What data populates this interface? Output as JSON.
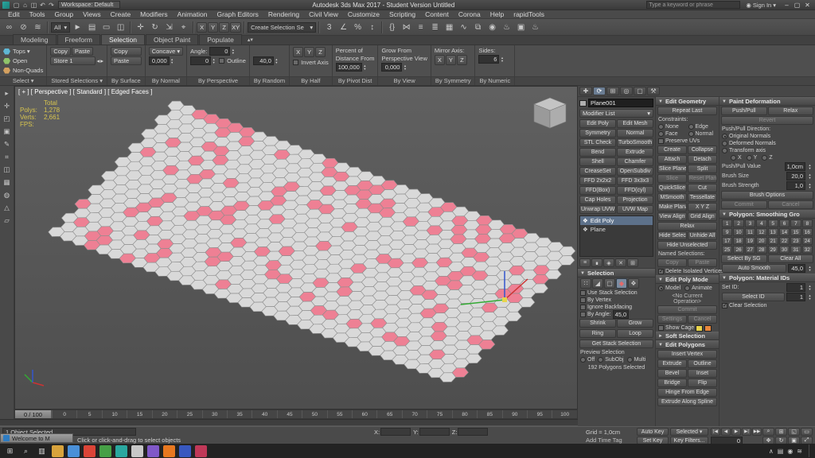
{
  "colors": {
    "accent": "#5d718a",
    "selection_pink": "#ee8094",
    "stats_yellow": "#d8c54f"
  },
  "title": {
    "workspace": "Workspace: Default",
    "text": "Autodesk 3ds Max 2017  -  Student Version   Untitled",
    "search_placeholder": "Type a keyword or phrase",
    "sign_in": "Sign In",
    "qicons": [
      {
        "g": "▢",
        "n": "new-scene-icon"
      },
      {
        "g": "⌂",
        "n": "open-file-icon"
      },
      {
        "g": "◫",
        "n": "save-file-icon"
      },
      {
        "g": "↶",
        "n": "undo-icon"
      },
      {
        "g": "↷",
        "n": "redo-icon"
      }
    ],
    "win": [
      {
        "g": "–",
        "n": "minimize-button"
      },
      {
        "g": "▢",
        "n": "maximize-button"
      },
      {
        "g": "✕",
        "n": "close-button"
      }
    ]
  },
  "menus": [
    "Edit",
    "Tools",
    "Group",
    "Views",
    "Create",
    "Modifiers",
    "Animation",
    "Graph Editors",
    "Rendering",
    "Civil View",
    "Customize",
    "Scripting",
    "Content",
    "Corona",
    "Help",
    "rapidTools"
  ],
  "toolbar": {
    "filter": "All",
    "sel_set": "Create Selection Se",
    "axis": [
      "X",
      "Y",
      "Z",
      "XY"
    ],
    "g1": [
      {
        "g": "∞",
        "n": "select-and-link-icon"
      },
      {
        "g": "⊘",
        "n": "unlink-selection-icon"
      },
      {
        "g": "≋",
        "n": "bind-to-space-warp-icon"
      }
    ],
    "g2": [
      {
        "g": "►",
        "n": "select-object-icon"
      },
      {
        "g": "▤",
        "n": "select-by-name-icon"
      },
      {
        "g": "▭",
        "n": "rectangular-selection-region-icon"
      },
      {
        "g": "◫",
        "n": "window-crossing-icon"
      }
    ],
    "g3": [
      {
        "g": "✛",
        "n": "select-and-move-icon"
      },
      {
        "g": "↻",
        "n": "select-and-rotate-icon"
      },
      {
        "g": "⇲",
        "n": "select-and-scale-icon"
      },
      {
        "g": "⌖",
        "n": "select-and-place-icon"
      }
    ],
    "g4": [
      {
        "g": "3",
        "n": "snap-toggle-icon"
      },
      {
        "g": "∠",
        "n": "angle-snap-icon"
      },
      {
        "g": "%",
        "n": "percent-snap-icon"
      },
      {
        "g": "↕",
        "n": "spinner-snap-icon"
      }
    ],
    "g5": [
      {
        "g": "{}",
        "n": "edit-named-selections-icon"
      },
      {
        "g": "⋈",
        "n": "mirror-icon"
      },
      {
        "g": "≡",
        "n": "align-icon"
      },
      {
        "g": "≣",
        "n": "layer-manager-icon"
      },
      {
        "g": "▦",
        "n": "ribbon-toggle-icon"
      },
      {
        "g": "∿",
        "n": "curve-editor-icon"
      },
      {
        "g": "⧉",
        "n": "schematic-view-icon"
      },
      {
        "g": "◉",
        "n": "material-editor-icon"
      },
      {
        "g": "♨",
        "n": "render-setup-icon"
      },
      {
        "g": "▣",
        "n": "rendered-frame-icon"
      },
      {
        "g": "♨",
        "n": "render-production-icon"
      }
    ]
  },
  "ribbon": {
    "tabs": [
      {
        "l": "Modeling"
      },
      {
        "l": "Freeform"
      },
      {
        "l": "Selection",
        "sel": true
      },
      {
        "l": "Object Paint"
      },
      {
        "l": "Populate"
      }
    ],
    "g1": {
      "items": [
        {
          "l": "Tops ▾",
          "c": "#5fb7d4"
        },
        {
          "l": "Open",
          "c": "#8fc46a"
        },
        {
          "l": "Non-Quads",
          "c": "#d4a05f"
        }
      ],
      "footer": "Select ▾"
    },
    "g2": {
      "copy": "Copy",
      "paste": "Paste",
      "store": "Store 1",
      "footer": "Stored Selections ▾"
    },
    "g3": {
      "copy": "Copy",
      "paste": "Paste",
      "footer": "By Surface"
    },
    "g4": {
      "btn": "Concave ▾",
      "spin": "0,000",
      "footer": "By Normal"
    },
    "g5": {
      "label": "Angle:",
      "spin1": "0",
      "spin2": "0",
      "check": "Outline",
      "footer": "By Perspective"
    },
    "g6": {
      "spin": "40,0",
      "footer": "By Random"
    },
    "g7": {
      "axes": [
        "X",
        "Y",
        "Z"
      ],
      "check": "Invert Axis",
      "footer": "By Half"
    },
    "g8": {
      "l1": "Percent of",
      "l2": "Distance From",
      "spin": "100,000",
      "footer": "By Pivot Dist"
    },
    "g9": {
      "l1": "Grow From",
      "l2": "Perspective View",
      "spin": "0,000",
      "footer": "By View"
    },
    "g10": {
      "label": "Mirror Axis:",
      "axes": [
        "X",
        "Y",
        "Z"
      ],
      "footer": "By Symmetry"
    },
    "g11": {
      "label": "Sides:",
      "spin": "6",
      "footer": "By Numeric"
    }
  },
  "left_tools": [
    {
      "g": "▸",
      "n": "viewport-layout-tabs-icon"
    },
    {
      "g": "✛",
      "n": "left-toolbar-icon"
    },
    {
      "g": "◰",
      "n": "left-toolbar-icon"
    },
    {
      "g": "▣",
      "n": "left-toolbar-icon"
    },
    {
      "g": "✎",
      "n": "left-toolbar-icon"
    },
    {
      "g": "⌗",
      "n": "left-toolbar-icon"
    },
    {
      "g": "◫",
      "n": "left-toolbar-icon"
    },
    {
      "g": "▦",
      "n": "left-toolbar-icon"
    },
    {
      "g": "◍",
      "n": "left-toolbar-icon"
    },
    {
      "g": "△",
      "n": "left-toolbar-icon"
    },
    {
      "g": "▱",
      "n": "left-toolbar-icon"
    }
  ],
  "viewport": {
    "label": "[ + ] [ Perspective ] [ Standard ] [ Edged Faces ]",
    "stats": {
      "rows": [
        [
          "",
          "Total"
        ],
        [
          "Polys:",
          "1,278"
        ],
        [
          "Verts:",
          "2,661"
        ],
        [
          "FPS:",
          ""
        ]
      ]
    },
    "axis_colors": {
      "x": "#cc3333",
      "y": "#33aa33",
      "z": "#3355cc"
    },
    "plane": {
      "cols": 34,
      "rows": 19,
      "ratio": 0.17,
      "seed": 13,
      "fill": "#d9d9d9",
      "sel_fill": "#ee8094",
      "stroke": "#8d8d8d",
      "matrix": [
        506.5,
        188.5,
        -158.5,
        167.5,
        198.75,
        16.75
      ]
    }
  },
  "cp": {
    "tabs": [
      {
        "g": "✚",
        "n": "create-tab-icon"
      },
      {
        "g": "⟳",
        "n": "modify-tab-icon",
        "sel": true
      },
      {
        "g": "⊞",
        "n": "hierarchy-tab-icon"
      },
      {
        "g": "◎",
        "n": "motion-tab-icon"
      },
      {
        "g": "▢",
        "n": "display-tab-icon"
      },
      {
        "g": "⚒",
        "n": "utilities-tab-icon"
      }
    ],
    "name": "Plane001",
    "modifier_list": "Modifier List",
    "modsets": [
      [
        "Edit Poly",
        "Edit Mesh"
      ],
      [
        "Symmetry",
        "Normal"
      ],
      [
        "STL Check",
        "TurboSmooth"
      ],
      [
        "Bend",
        "Extrude"
      ],
      [
        "Shell",
        "Chamfer"
      ],
      [
        "CreaseSet",
        "OpenSubdiv"
      ],
      [
        "FFD 2x2x2",
        "FFD 3x3x3"
      ],
      [
        "FFD(Box)",
        "FFD(cyl)"
      ],
      [
        "Cap Holes",
        "Projection"
      ],
      [
        "Unwrap UVW",
        "UVW Map"
      ]
    ],
    "stack": [
      {
        "l": "Edit Poly",
        "sel": true
      },
      {
        "l": "Plane"
      }
    ],
    "stack_tools": [
      {
        "g": "≡",
        "n": "pin-stack-icon"
      },
      {
        "g": "∎",
        "n": "show-end-result-icon"
      },
      {
        "g": "◈",
        "n": "make-unique-icon"
      },
      {
        "g": "✕",
        "n": "remove-modifier-icon"
      },
      {
        "g": "⊞",
        "n": "configure-modifier-sets-icon"
      }
    ],
    "sel": {
      "title": "Selection",
      "modes": [
        {
          "g": "∷",
          "n": "vertex-mode-icon"
        },
        {
          "g": "◢",
          "n": "edge-mode-icon"
        },
        {
          "g": "▢",
          "n": "border-mode-icon"
        },
        {
          "g": "◆",
          "n": "polygon-mode-icon",
          "sel": true,
          "c": "#e36a6a"
        },
        {
          "g": "❖",
          "n": "element-mode-icon"
        }
      ],
      "checks": [
        "Use Stack Selection",
        "By Vertex",
        "Ignore Backfacing"
      ],
      "by_angle": "By Angle:",
      "angle": "45,0",
      "shrink": "Shrink",
      "grow": "Grow",
      "ring": "Ring",
      "loop": "Loop",
      "get_stack": "Get Stack Selection",
      "preview": "Preview Selection",
      "preview_opts": [
        {
          "l": "Off",
          "sel": true
        },
        {
          "l": "SubObj"
        },
        {
          "l": "Multi"
        }
      ],
      "status": "192 Polygons Selected"
    },
    "eg": {
      "title": "Edit Geometry",
      "repeat": "Repeat Last",
      "constraints": "Constraints:",
      "cons": [
        {
          "l": "None",
          "sel": true
        },
        {
          "l": "Edge"
        },
        {
          "l": "Face"
        },
        {
          "l": "Normal"
        }
      ],
      "preserve": "Preserve UVs",
      "pairs": [
        [
          "Create",
          "Collapse"
        ],
        [
          "Attach",
          "Detach"
        ],
        [
          "Slice Plane",
          "Split"
        ],
        [
          "Slice",
          "Reset Plane"
        ],
        [
          "QuickSlice",
          "Cut"
        ],
        [
          "MSmooth",
          "Tessellate"
        ],
        [
          "Make Planar",
          "X Y Z"
        ],
        [
          "View Align",
          "Grid Align"
        ]
      ],
      "relax": "Relax",
      "hide1": "Hide Selected",
      "hide2": "Unhide All",
      "hide3": "Hide Unselected",
      "named": "Named Selections:",
      "copy": "Copy",
      "paste": "Paste",
      "del_iso": "Delete Isolated Vertices"
    },
    "epm": {
      "title": "Edit Poly Mode",
      "model": "Model",
      "animate": "Animate",
      "current": "<No Current Operation>",
      "commit": "Commit",
      "settings": "Settings",
      "cancel": "Cancel",
      "cage": "Show Cage"
    },
    "soft": {
      "title": "Soft Selection"
    },
    "ep": {
      "title": "Edit Polygons",
      "insert": "Insert Vertex",
      "pairs": [
        [
          "Extrude",
          "Outline"
        ],
        [
          "Bevel",
          "Inset"
        ],
        [
          "Bridge",
          "Flip"
        ]
      ],
      "hinge": "Hinge From Edge",
      "spline": "Extrude Along Spline"
    },
    "paint": {
      "title": "Paint Deformation",
      "b1": "Push/Pull",
      "b2": "Relax",
      "revert": "Revert",
      "dir": "Push/Pull Direction:",
      "r1": "Original Normals",
      "r2": "Deformed Normals",
      "r3": "Transform axis",
      "axes": [
        "X",
        "Y",
        "Z"
      ],
      "rows": [
        [
          "Push/Pull Value",
          "1,0cm"
        ],
        [
          "Brush Size",
          "20,0"
        ],
        [
          "Brush Strength",
          "1,0"
        ]
      ],
      "options": "Brush Options",
      "commit": "Commit",
      "cancel": "Cancel"
    },
    "smooth": {
      "title": "Polygon: Smoothing Gro",
      "nums": [
        "1",
        "2",
        "3",
        "4",
        "5",
        "6",
        "7",
        "8",
        "9",
        "10",
        "11",
        "12",
        "13",
        "14",
        "15",
        "16",
        "17",
        "18",
        "19",
        "20",
        "21",
        "22",
        "23",
        "24",
        "25",
        "26",
        "27",
        "28",
        "29",
        "30",
        "31",
        "32"
      ],
      "by_sg": "Select By SG",
      "clear": "Clear All",
      "auto": "Auto Smooth",
      "auto_val": "45,0"
    },
    "matid": {
      "title": "Polygon: Material IDs",
      "set_id": "Set ID:",
      "set_val": "1",
      "sel_id": "Select ID",
      "sel_val": "1",
      "clear": "Clear Selection"
    }
  },
  "timeline": {
    "slider": "0 / 100",
    "ticks": [
      "0",
      "5",
      "10",
      "15",
      "20",
      "25",
      "30",
      "35",
      "40",
      "45",
      "50",
      "55",
      "60",
      "65",
      "70",
      "75",
      "80",
      "85",
      "90",
      "95",
      "100"
    ]
  },
  "status": {
    "line1": "1 Object Selected",
    "line2": "Click or click-and-drag to select objects",
    "welcome": "Welcome to M",
    "coords": [
      "X:",
      "Y:",
      "Z:"
    ],
    "grid": "Grid = 1,0cm",
    "time_tag": "Add Time Tag",
    "auto_key": "Auto Key",
    "selected": "Selected ▾",
    "set_key": "Set Key",
    "key_filters": "Key Filters...",
    "frame": "0",
    "playback": [
      {
        "g": "|◀",
        "n": "go-to-start-button"
      },
      {
        "g": "◀",
        "n": "previous-frame-button"
      },
      {
        "g": "▶",
        "n": "play-button"
      },
      {
        "g": "▶|",
        "n": "next-frame-button"
      },
      {
        "g": "▶▶",
        "n": "go-to-end-button"
      }
    ],
    "nav": [
      {
        "g": "⌕",
        "n": "zoom-icon"
      },
      {
        "g": "⊞",
        "n": "zoom-all-icon"
      },
      {
        "g": "◱",
        "n": "zoom-extents-icon"
      },
      {
        "g": "▭",
        "n": "zoom-region-icon"
      },
      {
        "g": "✥",
        "n": "pan-icon"
      },
      {
        "g": "↻",
        "n": "orbit-icon"
      },
      {
        "g": "▣",
        "n": "maximize-viewport-icon"
      },
      {
        "g": "⤢",
        "n": "zoom-extents-all-icon"
      }
    ]
  },
  "taskbar": {
    "start": "⊞",
    "icons": [
      {
        "g": "⌕",
        "n": "taskbar-search-icon"
      },
      {
        "g": "▥",
        "n": "task-view-icon"
      },
      {
        "bg": "#d8a33c",
        "n": "file-explorer-icon"
      },
      {
        "bg": "#4a90d9",
        "n": "app-icon"
      },
      {
        "bg": "#db4437",
        "n": "app-icon"
      },
      {
        "bg": "#46a046",
        "n": "app-icon"
      },
      {
        "bg": "#2aa8a0",
        "n": "3ds-max-taskbar-icon"
      },
      {
        "bg": "#c8c8c8",
        "n": "app-icon"
      },
      {
        "bg": "#8058c8",
        "n": "app-icon"
      },
      {
        "bg": "#e87820",
        "n": "app-icon"
      },
      {
        "bg": "#3858c0",
        "n": "app-icon"
      },
      {
        "bg": "#c03858",
        "n": "app-icon"
      }
    ],
    "tray": [
      {
        "g": "∧",
        "n": "tray-chevron-icon"
      },
      {
        "g": "▤",
        "n": "tray-icon"
      },
      {
        "g": "◉",
        "n": "tray-icon"
      },
      {
        "g": "≋",
        "n": "tray-icon"
      }
    ]
  }
}
